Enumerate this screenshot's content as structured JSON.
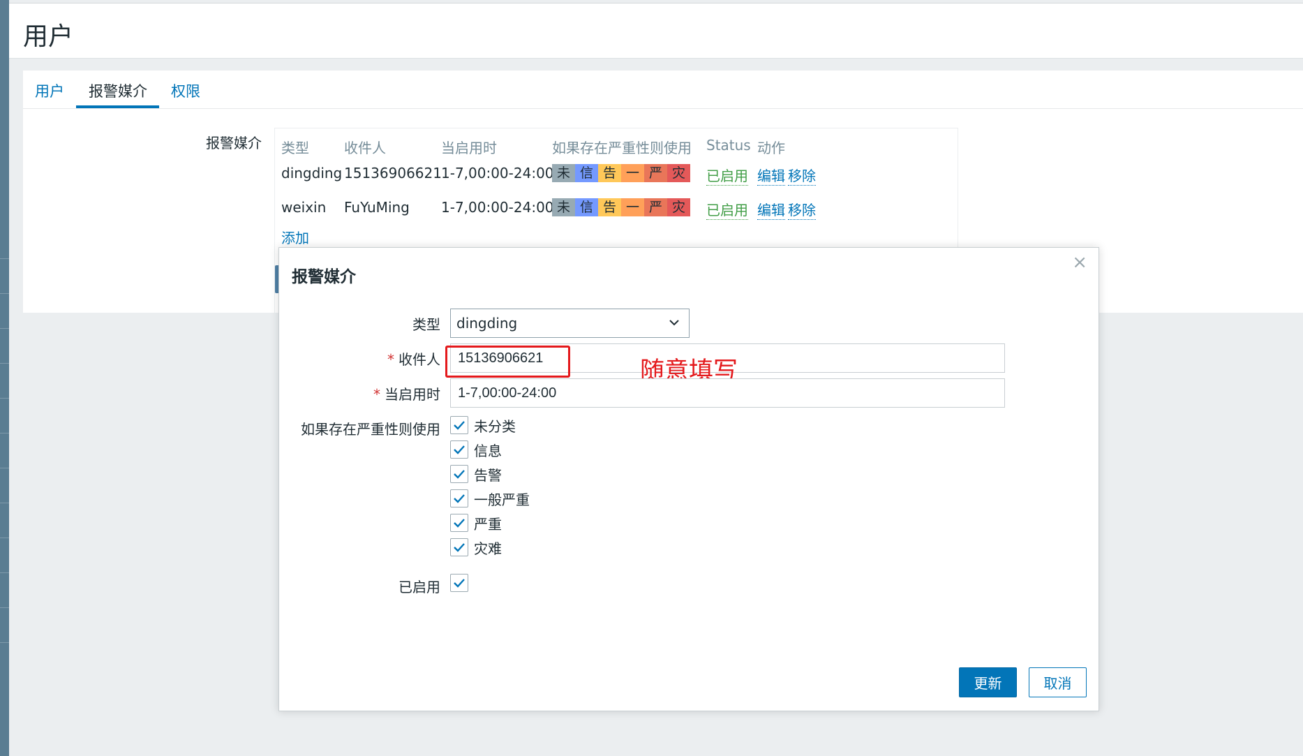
{
  "page": {
    "title": "用户"
  },
  "tabs": [
    {
      "label": "用户"
    },
    {
      "label": "报警媒介"
    },
    {
      "label": "权限"
    }
  ],
  "media": {
    "label": "报警媒介",
    "columns": [
      "类型",
      "收件人",
      "当启用时",
      "如果存在严重性则使用",
      "Status",
      "动作"
    ],
    "severity_letters": [
      "未",
      "信",
      "告",
      "一",
      "严",
      "灾"
    ],
    "severity_colors": [
      "#97aab3",
      "#7499ff",
      "#ffc859",
      "#ffa059",
      "#e97659",
      "#e45959"
    ],
    "rows": [
      {
        "type": "dingding",
        "recipient": "15136906621",
        "when": "1-7,00:00-24:00",
        "status": "已启用",
        "edit": "编辑",
        "remove": "移除"
      },
      {
        "type": "weixin",
        "recipient": "FuYuMing",
        "when": "1-7,00:00-24:00",
        "status": "已启用",
        "edit": "编辑",
        "remove": "移除"
      }
    ],
    "add_link": "添加"
  },
  "dialog": {
    "title": "报警媒介",
    "close_glyph": "×",
    "type_label": "类型",
    "type_value": "dingding",
    "recipient_label": "收件人",
    "recipient_value": "15136906621",
    "when_label": "当启用时",
    "when_value": "1-7,00:00-24:00",
    "severity_label": "如果存在严重性则使用",
    "severities": [
      "未分类",
      "信息",
      "告警",
      "一般严重",
      "严重",
      "灾难"
    ],
    "enabled_label": "已启用",
    "annotation": "随意填写",
    "update_button": "更新",
    "cancel_button": "取消"
  }
}
